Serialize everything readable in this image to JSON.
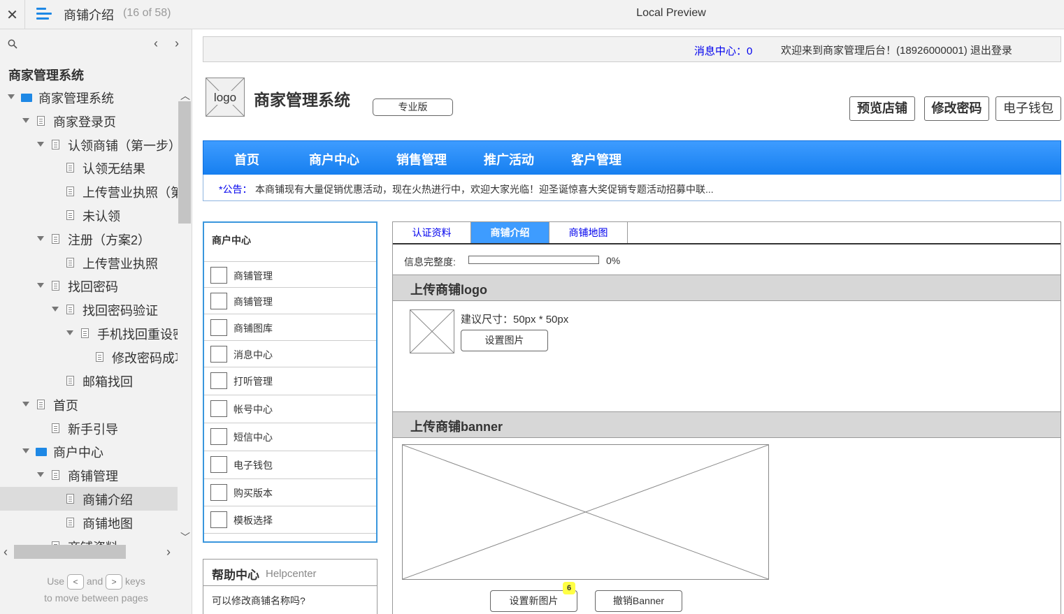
{
  "viewer": {
    "close_glyph": "✕",
    "page_title": "商铺介绍",
    "page_count": "(16 of 58)",
    "preview_title": "Local Preview",
    "project_name": "商家管理系统",
    "prev_glyph": "‹",
    "next_glyph": "›",
    "hint_use": "Use",
    "hint_and": "and",
    "hint_keys": "keys",
    "hint_line2": "to move between pages",
    "key_prev": "<",
    "key_next": ">"
  },
  "tree": [
    {
      "label": "商家管理系统",
      "icon": "folder-icon",
      "expanded": true
    },
    {
      "label": "商家登录页",
      "icon": "page-icon",
      "expanded": true
    },
    {
      "label": "认领商铺（第一步）",
      "icon": "page-icon",
      "expanded": true
    },
    {
      "label": "认领无结果",
      "icon": "page-icon"
    },
    {
      "label": "上传营业执照（第",
      "icon": "page-icon"
    },
    {
      "label": "未认领",
      "icon": "page-icon"
    },
    {
      "label": "注册（方案2）",
      "icon": "page-icon",
      "expanded": true
    },
    {
      "label": "上传营业执照",
      "icon": "page-icon"
    },
    {
      "label": "找回密码",
      "icon": "page-icon",
      "expanded": true
    },
    {
      "label": "找回密码验证",
      "icon": "page-icon",
      "expanded": true
    },
    {
      "label": "手机找回重设密",
      "icon": "page-icon",
      "expanded": true
    },
    {
      "label": "修改密码成功",
      "icon": "page-icon"
    },
    {
      "label": "邮箱找回",
      "icon": "page-icon"
    },
    {
      "label": "首页",
      "icon": "page-icon",
      "expanded": true
    },
    {
      "label": "新手引导",
      "icon": "page-icon"
    },
    {
      "label": "商户中心",
      "icon": "folder-icon",
      "expanded": true
    },
    {
      "label": "商铺管理",
      "icon": "page-icon",
      "expanded": true
    },
    {
      "label": "商铺介绍",
      "icon": "page-icon",
      "selected": true
    },
    {
      "label": "商铺地图",
      "icon": "page-icon"
    },
    {
      "label": "商铺资料",
      "icon": "page-icon"
    }
  ],
  "app": {
    "msg_center": "消息中心：0",
    "welcome": "欢迎来到商家管理后台！(18926000001)   退出登录",
    "logo_text": "logo",
    "system_name": "商家管理系统",
    "edition": "专业版",
    "top_buttons": [
      "预览店铺",
      "修改密码",
      "电子钱包"
    ],
    "nav": [
      "首页",
      "商户中心",
      "销售管理",
      "推广活动",
      "客户管理"
    ],
    "notice_tag": "*公告：",
    "notice_text": "本商铺现有大量促销优惠活动，现在火热进行中，欢迎大家光临！迎圣诞惊喜大奖促销专题活动招募中联...",
    "left_head": "商户中心",
    "left_items": [
      "商铺管理",
      "商铺管理",
      "商铺图库",
      "消息中心",
      "打听管理",
      "帐号中心",
      "短信中心",
      "电子钱包",
      "购买版本",
      "模板选择"
    ],
    "help_title": "帮助中心",
    "help_sub": "Helpcenter",
    "help_q": "可以修改商铺名称吗?",
    "tabs": [
      "认证资料",
      "商铺介绍",
      "商铺地图"
    ],
    "active_tab": 1,
    "progress_label": "信息完整度:",
    "progress_value": 0,
    "progress_text": "0%",
    "logo_section": "上传商铺logo",
    "size_hint": "建议尺寸：50px * 50px",
    "set_image": "设置图片",
    "banner_section": "上传商铺banner",
    "set_new_image": "设置新图片",
    "badge": "6",
    "cancel_banner": "撤销Banner"
  },
  "colors": {
    "accent": "#1e88e5",
    "nav_blue": "#167ff0",
    "link": "#0000ee"
  }
}
